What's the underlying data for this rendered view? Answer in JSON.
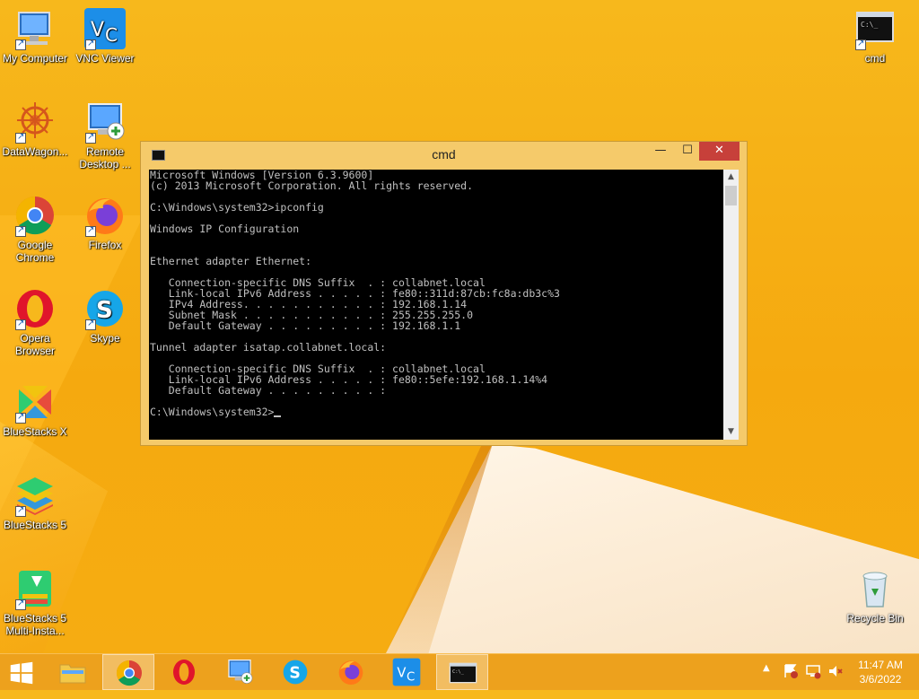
{
  "desktop": {
    "icons": [
      {
        "label": "My Computer"
      },
      {
        "label": "VNC Viewer"
      },
      {
        "label": "DataWagon..."
      },
      {
        "label": "Remote Desktop ..."
      },
      {
        "label": "Google Chrome"
      },
      {
        "label": "Firefox"
      },
      {
        "label": "Opera Browser"
      },
      {
        "label": "Skype"
      },
      {
        "label": "BlueStacks X"
      },
      {
        "label": "BlueStacks 5"
      },
      {
        "label": "BlueStacks 5 Multi-Insta..."
      },
      {
        "label": "cmd"
      },
      {
        "label": "Recycle Bin"
      }
    ]
  },
  "window": {
    "title": "cmd",
    "controls": {
      "minimize": "—",
      "maximize": "☐",
      "close": "✕"
    },
    "console_lines": [
      "Microsoft Windows [Version 6.3.9600]",
      "(c) 2013 Microsoft Corporation. All rights reserved.",
      "",
      "C:\\Windows\\system32>ipconfig",
      "",
      "Windows IP Configuration",
      "",
      "",
      "Ethernet adapter Ethernet:",
      "",
      "   Connection-specific DNS Suffix  . : collabnet.local",
      "   Link-local IPv6 Address . . . . . : fe80::311d:87cb:fc8a:db3c%3",
      "   IPv4 Address. . . . . . . . . . . : 192.168.1.14",
      "   Subnet Mask . . . . . . . . . . . : 255.255.255.0",
      "   Default Gateway . . . . . . . . . : 192.168.1.1",
      "",
      "Tunnel adapter isatap.collabnet.local:",
      "",
      "   Connection-specific DNS Suffix  . : collabnet.local",
      "   Link-local IPv6 Address . . . . . : fe80::5efe:192.168.1.14%4",
      "   Default Gateway . . . . . . . . . :",
      ""
    ],
    "prompt": "C:\\Windows\\system32>"
  },
  "taskbar": {
    "items": [
      "start",
      "file-explorer",
      "chrome",
      "opera",
      "remote-desktop",
      "skype",
      "firefox",
      "vnc-viewer",
      "cmd"
    ],
    "clock": {
      "time": "11:47 AM",
      "date": "3/6/2022"
    }
  },
  "colors": {
    "desktop": "#f6ab14",
    "titlebar": "#f5ca6a",
    "close": "#c7403a",
    "console_bg": "#000000",
    "console_fg": "#c0c0c0"
  }
}
